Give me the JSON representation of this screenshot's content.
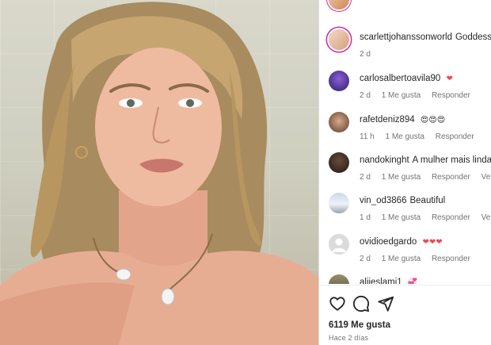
{
  "post": {
    "likes_label": "6119 Me gusta",
    "time_ago": "Hace 2 días"
  },
  "comments": [
    {
      "user": "scarlettjohanssonworld",
      "text": "Goddess",
      "emoji": "❤",
      "time": "2 d",
      "likes": "",
      "reply": "",
      "more": ""
    },
    {
      "user": "carlosalbertoavila90",
      "text": "",
      "emoji": "❤",
      "time": "2 d",
      "likes": "1 Me gusta",
      "reply": "Responder",
      "more": ""
    },
    {
      "user": "rafetdeniz894",
      "text": "",
      "emoji": "😍😍😍",
      "time": "11 h",
      "likes": "1 Me gusta",
      "reply": "Responder",
      "more": ""
    },
    {
      "user": "nandokinght",
      "text": "A mulher mais linda",
      "emoji": "",
      "time": "2 d",
      "likes": "1 Me gusta",
      "reply": "Responder",
      "more": "Ver trad"
    },
    {
      "user": "vin_od3866",
      "text": "Beautiful",
      "emoji": "",
      "time": "1 d",
      "likes": "1 Me gusta",
      "reply": "Responder",
      "more": "Ver trad"
    },
    {
      "user": "ovidioedgardo",
      "text": "",
      "emoji": "❤❤❤",
      "time": "2 d",
      "likes": "1 Me gusta",
      "reply": "Responder",
      "more": ""
    },
    {
      "user": "aliieslami1",
      "text": "",
      "emoji": "💞",
      "time": "",
      "likes": "",
      "reply": "",
      "more": ""
    }
  ],
  "icons": {
    "like": "heart-outline-icon",
    "comment": "comment-bubble-icon",
    "share": "paper-plane-icon"
  },
  "colors": {
    "heart": "#ed4956",
    "link_blue": "#0095f6",
    "meta_gray": "#737373"
  }
}
